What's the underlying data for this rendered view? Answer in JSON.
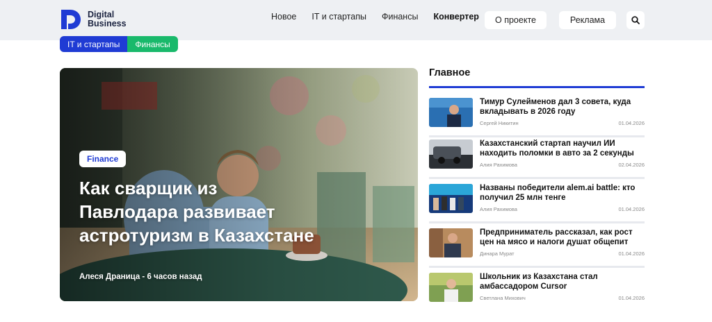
{
  "brand": {
    "line1": "Digital",
    "line2": "Business"
  },
  "nav": {
    "items": [
      "Новое",
      "IT и стартапы",
      "Финансы",
      "Конвертер"
    ],
    "about": "О проекте",
    "ads": "Реклама"
  },
  "categories": [
    "IT и стартапы",
    "Финансы"
  ],
  "hero": {
    "badge": "Finance",
    "title": "Как сварщик из Павлодара развивает астротуризм в Казахстане",
    "meta": "Алеся Драница - 6 часов назад"
  },
  "sidebar": {
    "title": "Главное",
    "items": [
      {
        "title": "Тимур Сулейменов дал 3 совета, куда вкладывать в 2026 году",
        "author": "Сергей Никитин",
        "date": "01.04.2026"
      },
      {
        "title": "Казахстанский стартап научил ИИ находить поломки в авто за 2 секунды",
        "author": "Алия Рахимова",
        "date": "02.04.2026"
      },
      {
        "title": "Названы победители alem.ai battle: кто получил 25 млн тенге",
        "author": "Алия Рахимова",
        "date": "01.04.2026"
      },
      {
        "title": "Предприниматель рассказал, как рост цен на мясо и налоги душат общепит",
        "author": "Динара Мурат",
        "date": "01.04.2026"
      },
      {
        "title": "Школьник из Казахстана стал амбассадором Cursor",
        "author": "Светлана Михович",
        "date": "01.04.2026"
      }
    ]
  },
  "colors": {
    "accent": "#1f3bd4",
    "green": "#19b96b",
    "header_bg": "#eef0f3"
  }
}
